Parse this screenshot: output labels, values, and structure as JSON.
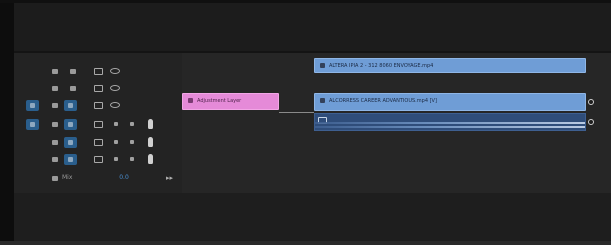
{
  "timeline": {
    "tracks": [
      {
        "id": "V3",
        "source_patch": false,
        "target": false,
        "kind": "video"
      },
      {
        "id": "V2",
        "source_patch": false,
        "target": false,
        "kind": "video"
      },
      {
        "id": "V1",
        "source_patch": true,
        "target": true,
        "kind": "video"
      },
      {
        "id": "A1",
        "source_patch": true,
        "target": true,
        "kind": "audio"
      },
      {
        "id": "A2",
        "source_patch": false,
        "target": true,
        "kind": "audio"
      },
      {
        "id": "A3",
        "source_patch": false,
        "target": true,
        "kind": "audio"
      },
      {
        "id": "Mix",
        "kind": "master"
      }
    ],
    "master": {
      "label": "Mix",
      "value": "0.0"
    },
    "clips": {
      "adjustment": {
        "label": "Adjustment Layer",
        "color": "#e58ad8"
      },
      "v2_clip": {
        "label": "ALTERA IPIA 2 - 312 8060 ENVOYAGE.mp4",
        "color": "#6f9dd6"
      },
      "v1_clip": {
        "label": "ALCORRESS CAREER ADVANTIOUS.mp4 [V]",
        "color": "#6f9dd6"
      },
      "a1_clip": {
        "color": "#2f4d7a"
      }
    }
  },
  "icons": {
    "lock": "lock-icon",
    "sync": "sync-lock-icon",
    "camera": "camera-icon",
    "eye": "eye-icon",
    "mute": "mute-icon",
    "solo": "solo-icon",
    "mic": "microphone-icon",
    "skip": "skip-to-end-icon",
    "fx": "fx-badge-icon"
  },
  "colors": {
    "accent": "#2a5e8c",
    "video_clip": "#6f9dd6",
    "adjustment_clip": "#e58ad8",
    "audio_clip": "#2f4d7a"
  }
}
